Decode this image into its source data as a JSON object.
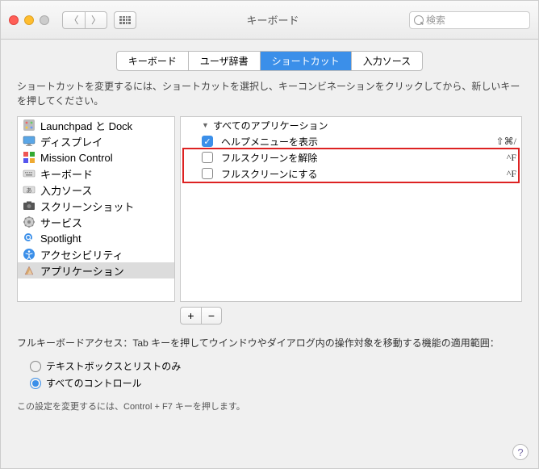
{
  "window": {
    "title": "キーボード"
  },
  "search": {
    "placeholder": "検索"
  },
  "tabs": [
    {
      "label": "キーボード",
      "active": false
    },
    {
      "label": "ユーザ辞書",
      "active": false
    },
    {
      "label": "ショートカット",
      "active": true
    },
    {
      "label": "入力ソース",
      "active": false
    }
  ],
  "hint": "ショートカットを変更するには、ショートカットを選択し、キーコンビネーションをクリックしてから、新しいキーを押してください。",
  "categories": [
    {
      "icon": "launchpad",
      "label": "Launchpad と Dock"
    },
    {
      "icon": "display",
      "label": "ディスプレイ"
    },
    {
      "icon": "mission",
      "label": "Mission Control"
    },
    {
      "icon": "keyboard",
      "label": "キーボード"
    },
    {
      "icon": "input",
      "label": "入力ソース"
    },
    {
      "icon": "screenshot",
      "label": "スクリーンショット"
    },
    {
      "icon": "services",
      "label": "サービス"
    },
    {
      "icon": "spotlight",
      "label": "Spotlight"
    },
    {
      "icon": "accessibility",
      "label": "アクセシビリティ"
    },
    {
      "icon": "app",
      "label": "アプリケーション",
      "selected": true
    }
  ],
  "shortcuts": {
    "group": "すべてのアプリケーション",
    "items": [
      {
        "checked": true,
        "label": "ヘルプメニューを表示",
        "key": "⇧⌘/"
      },
      {
        "checked": false,
        "label": "フルスクリーンを解除",
        "key": "^F",
        "highlight": true
      },
      {
        "checked": false,
        "label": "フルスクリーンにする",
        "key": "^F",
        "highlight": true
      }
    ]
  },
  "buttons": {
    "add": "+",
    "remove": "−"
  },
  "fullkeyboard": {
    "heading": "フルキーボードアクセス：Tab キーを押してウインドウやダイアログ内の操作対象を移動する機能の適用範囲：",
    "options": [
      {
        "label": "テキストボックスとリストのみ",
        "selected": false
      },
      {
        "label": "すべてのコントロール",
        "selected": true
      }
    ],
    "footnote": "この設定を変更するには、Control + F7 キーを押します。"
  },
  "help": "?"
}
